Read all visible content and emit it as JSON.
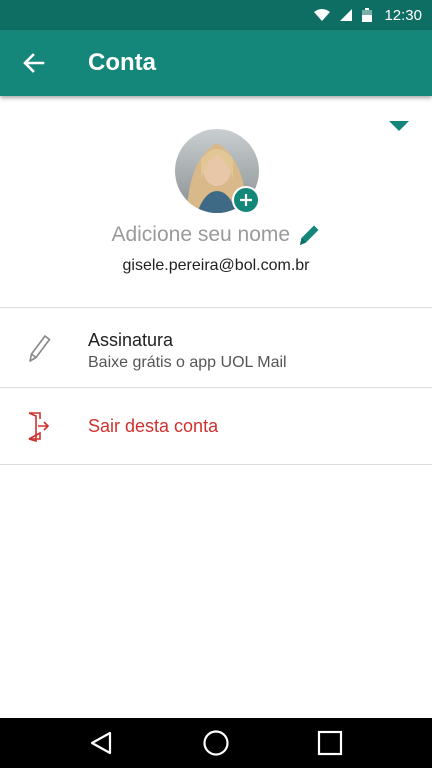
{
  "status_bar": {
    "time": "12:30",
    "icons": [
      "wifi-icon",
      "signal-icon",
      "battery-icon"
    ]
  },
  "app_bar": {
    "title": "Conta",
    "back_icon": "arrow-left-icon"
  },
  "profile": {
    "name_placeholder": "Adicione seu nome",
    "email": "gisele.pereira@bol.com.br"
  },
  "menu": {
    "signature": {
      "title": "Assinatura",
      "subtitle": "Baixe grátis o app UOL Mail",
      "icon": "pencil-icon"
    },
    "logout": {
      "title": "Sair desta conta",
      "icon": "logout-door-icon"
    }
  },
  "colors": {
    "status_bar": "#0e6e63",
    "app_bar": "#15867a",
    "accent": "#15867a",
    "danger": "#d0312d"
  },
  "nav_bar": {
    "icons": [
      "back-triangle-icon",
      "home-circle-icon",
      "recents-square-icon"
    ]
  }
}
